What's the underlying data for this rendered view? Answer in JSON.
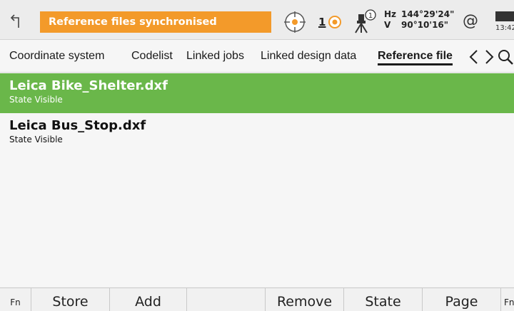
{
  "status": {
    "message": "Reference files synchronised",
    "prism_number": "1",
    "angles": {
      "hz_label": "Hz",
      "hz_value": "144°29'24\"",
      "v_label": "V",
      "v_value": "90°10'16\""
    },
    "at_symbol": "@",
    "clock": "13:42",
    "colors": {
      "message_bg": "#f39a2a",
      "selected_row": "#6ab74a"
    }
  },
  "tabs": [
    {
      "label": "Coordinate system"
    },
    {
      "label": "Codelist"
    },
    {
      "label": "Linked jobs"
    },
    {
      "label": "Linked design data"
    },
    {
      "label": "Reference file"
    }
  ],
  "files": [
    {
      "name": "Leica Bike_Shelter.dxf",
      "state_label": "State",
      "state_value": "Visible"
    },
    {
      "name": "Leica Bus_Stop.dxf",
      "state_label": "State",
      "state_value": "Visible"
    }
  ],
  "fkeys": {
    "fn_left": "Fn",
    "store": "Store",
    "add": "Add",
    "empty1": "",
    "remove": "Remove",
    "state": "State",
    "page": "Page",
    "fn_right": "Fn"
  }
}
